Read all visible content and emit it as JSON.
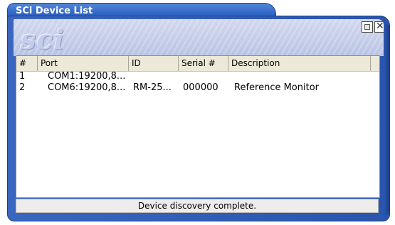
{
  "window": {
    "title": "SCi Device List",
    "logo_text": "sci"
  },
  "controls": {
    "restore_icon": "restore-icon",
    "close_icon": "close-icon",
    "close_glyph": "✕"
  },
  "list": {
    "columns": [
      "#",
      "Port",
      "ID",
      "Serial #",
      "Description"
    ],
    "rows": [
      {
        "num": "1",
        "port": "COM1:19200,8...",
        "id": "",
        "serial": "",
        "description": ""
      },
      {
        "num": "2",
        "port": "COM6:19200,8...",
        "id": "RM-25...",
        "serial": "000000",
        "description": "Reference Monitor"
      }
    ]
  },
  "status": {
    "text": "Device discovery complete."
  },
  "colors": {
    "title_blue": "#2f63c4",
    "frame_blue": "#3a66c0",
    "header_band": "#c6cee9"
  }
}
